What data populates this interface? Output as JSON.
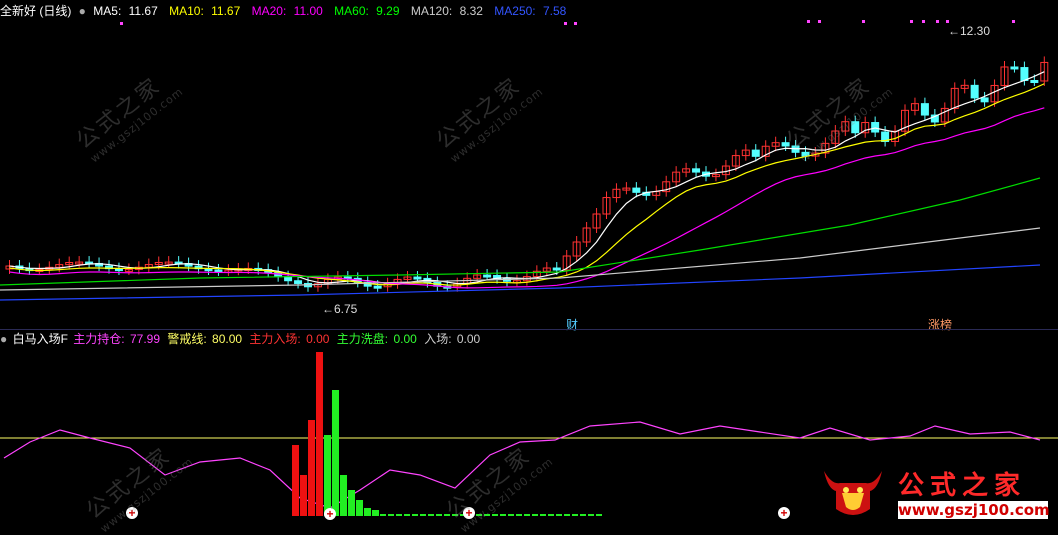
{
  "main_header": {
    "title": "全新好 (日线)",
    "ma": [
      {
        "label": "MA5:",
        "value": "11.67",
        "color": "#ffffff"
      },
      {
        "label": "MA10:",
        "value": "11.67",
        "color": "#ffff00"
      },
      {
        "label": "MA20:",
        "value": "11.00",
        "color": "#ff00ff"
      },
      {
        "label": "MA60:",
        "value": "9.29",
        "color": "#00ff00"
      },
      {
        "label": "MA120:",
        "value": "8.32",
        "color": "#cccccc"
      },
      {
        "label": "MA250:",
        "value": "7.58",
        "color": "#3355ff"
      }
    ]
  },
  "annotations": {
    "low": "6.75",
    "high": "12.30",
    "cai": "财",
    "zhangbang": "涨榜"
  },
  "indicator_header": {
    "name": "白马入场F",
    "items": [
      {
        "label": "主力持仓:",
        "value": "77.99",
        "color": "#ff44ff"
      },
      {
        "label": "警戒线:",
        "value": "80.00",
        "color": "#ffff66"
      },
      {
        "label": "主力入场:",
        "value": "0.00",
        "color": "#ff3333"
      },
      {
        "label": "主力洗盘:",
        "value": "0.00",
        "color": "#33ff33"
      },
      {
        "label": "入场:",
        "value": "0.00",
        "color": "#cccccc"
      }
    ]
  },
  "watermark": {
    "text": "公式之家",
    "url": "www.gszj100.com"
  },
  "brand": {
    "name": "公式之家",
    "url": "www.gszj100.com"
  },
  "colors": {
    "up": "#ff3232",
    "down": "#54ffff",
    "bg": "#000000"
  }
}
